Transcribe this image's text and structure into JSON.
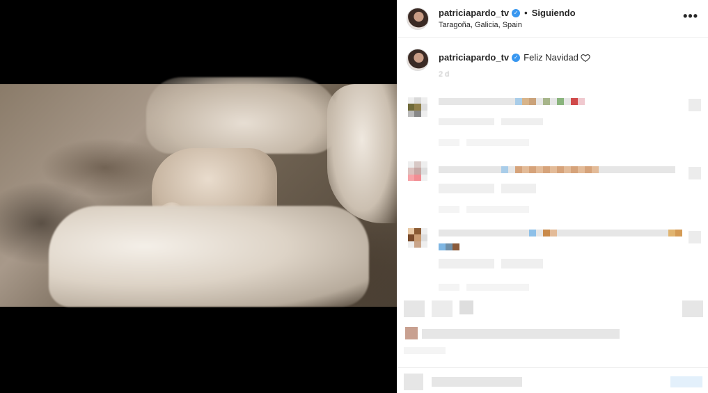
{
  "post": {
    "username": "patriciapardo_tv",
    "follow_status": "Siguiendo",
    "location": "Taragoña, Galicia, Spain",
    "more_label": "•••",
    "caption_text": "Feliz Navidad",
    "time_ago": "2 d"
  },
  "icons": {
    "verified": "verified-badge-icon",
    "heart": "heart-outline-icon",
    "more": "more-options-icon"
  },
  "colors": {
    "verified": "#3897f0",
    "media_bg": "#000000",
    "panel_bg": "#ffffff"
  }
}
